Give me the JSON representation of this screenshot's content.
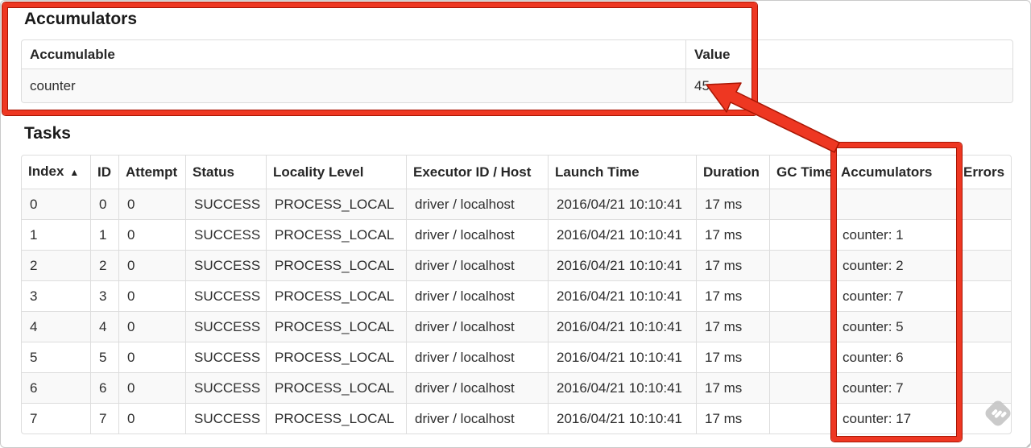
{
  "accumulators_section": {
    "title": "Accumulators",
    "headers": [
      "Accumulable",
      "Value"
    ],
    "row": {
      "accumulable": "counter",
      "value": "45"
    }
  },
  "tasks_section": {
    "title": "Tasks",
    "headers": [
      "Index",
      "ID",
      "Attempt",
      "Status",
      "Locality Level",
      "Executor ID / Host",
      "Launch Time",
      "Duration",
      "GC Time",
      "Accumulators",
      "Errors"
    ],
    "sort_icon": "▲",
    "sorted_by": "Index",
    "rows": [
      {
        "index": "0",
        "id": "0",
        "attempt": "0",
        "status": "SUCCESS",
        "locality": "PROCESS_LOCAL",
        "executor": "driver / localhost",
        "launch": "2016/04/21 10:10:41",
        "duration": "17 ms",
        "gc": "",
        "accum": "",
        "errors": ""
      },
      {
        "index": "1",
        "id": "1",
        "attempt": "0",
        "status": "SUCCESS",
        "locality": "PROCESS_LOCAL",
        "executor": "driver / localhost",
        "launch": "2016/04/21 10:10:41",
        "duration": "17 ms",
        "gc": "",
        "accum": "counter: 1",
        "errors": ""
      },
      {
        "index": "2",
        "id": "2",
        "attempt": "0",
        "status": "SUCCESS",
        "locality": "PROCESS_LOCAL",
        "executor": "driver / localhost",
        "launch": "2016/04/21 10:10:41",
        "duration": "17 ms",
        "gc": "",
        "accum": "counter: 2",
        "errors": ""
      },
      {
        "index": "3",
        "id": "3",
        "attempt": "0",
        "status": "SUCCESS",
        "locality": "PROCESS_LOCAL",
        "executor": "driver / localhost",
        "launch": "2016/04/21 10:10:41",
        "duration": "17 ms",
        "gc": "",
        "accum": "counter: 7",
        "errors": ""
      },
      {
        "index": "4",
        "id": "4",
        "attempt": "0",
        "status": "SUCCESS",
        "locality": "PROCESS_LOCAL",
        "executor": "driver / localhost",
        "launch": "2016/04/21 10:10:41",
        "duration": "17 ms",
        "gc": "",
        "accum": "counter: 5",
        "errors": ""
      },
      {
        "index": "5",
        "id": "5",
        "attempt": "0",
        "status": "SUCCESS",
        "locality": "PROCESS_LOCAL",
        "executor": "driver / localhost",
        "launch": "2016/04/21 10:10:41",
        "duration": "17 ms",
        "gc": "",
        "accum": "counter: 6",
        "errors": ""
      },
      {
        "index": "6",
        "id": "6",
        "attempt": "0",
        "status": "SUCCESS",
        "locality": "PROCESS_LOCAL",
        "executor": "driver / localhost",
        "launch": "2016/04/21 10:10:41",
        "duration": "17 ms",
        "gc": "",
        "accum": "counter: 7",
        "errors": ""
      },
      {
        "index": "7",
        "id": "7",
        "attempt": "0",
        "status": "SUCCESS",
        "locality": "PROCESS_LOCAL",
        "executor": "driver / localhost",
        "launch": "2016/04/21 10:10:41",
        "duration": "17 ms",
        "gc": "",
        "accum": "counter: 17",
        "errors": ""
      }
    ]
  },
  "annotation_colors": {
    "red": "#ee3722",
    "dark_red": "#a81604"
  }
}
